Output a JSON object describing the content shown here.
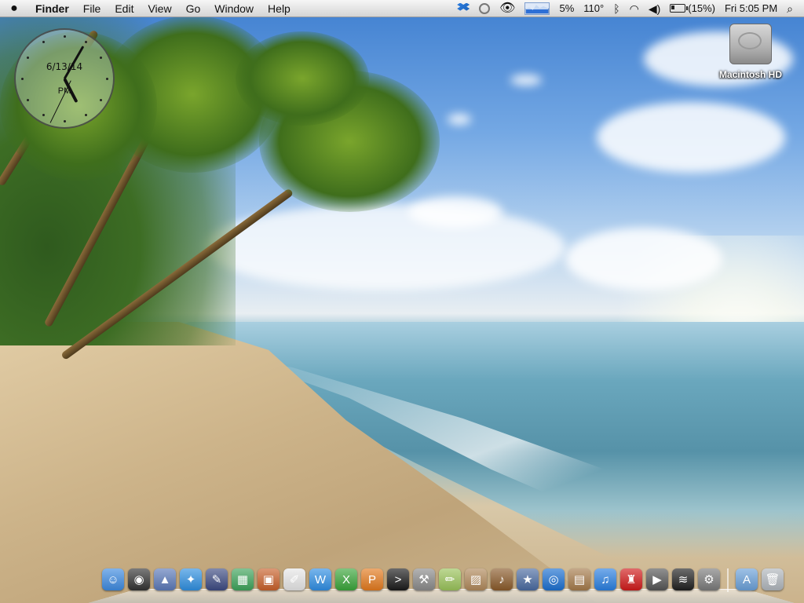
{
  "menubar": {
    "apple_icon": "apple-icon",
    "items": [
      "Finder",
      "File",
      "Edit",
      "View",
      "Go",
      "Window",
      "Help"
    ],
    "status": {
      "cpu_percent": "5%",
      "temperature": "110°",
      "battery_percent": "(15%)",
      "clock": "Fri 5:05 PM"
    }
  },
  "clock_widget": {
    "date": "6/13/14",
    "ampm": "PM",
    "hour": 5,
    "minute": 5
  },
  "desktop_icons": [
    {
      "label": "Macintosh HD",
      "icon": "hard-drive-icon"
    }
  ],
  "dock": {
    "apps": [
      {
        "name": "finder-icon",
        "color": "#3d8ae0",
        "glyph": "☺"
      },
      {
        "name": "dashboard-icon",
        "color": "#333333",
        "glyph": "◉"
      },
      {
        "name": "preview-icon",
        "color": "#5b79b8",
        "glyph": "▲"
      },
      {
        "name": "safari-icon",
        "color": "#2f8fe0",
        "glyph": "✦"
      },
      {
        "name": "quill-icon",
        "color": "#3c4a82",
        "glyph": "✎"
      },
      {
        "name": "numbers-icon",
        "color": "#3da35a",
        "glyph": "▦"
      },
      {
        "name": "keynote-icon",
        "color": "#c8602a",
        "glyph": "▣"
      },
      {
        "name": "textedit-icon",
        "color": "#e6e6e6",
        "glyph": "✐"
      },
      {
        "name": "word-icon",
        "color": "#2f8ee3",
        "glyph": "W"
      },
      {
        "name": "excel-icon",
        "color": "#3aa53a",
        "glyph": "X"
      },
      {
        "name": "powerpoint-icon",
        "color": "#e37a1e",
        "glyph": "P"
      },
      {
        "name": "terminal-icon",
        "color": "#1a1a1a",
        "glyph": ">"
      },
      {
        "name": "utility-icon",
        "color": "#8a8a8a",
        "glyph": "⚒"
      },
      {
        "name": "draw-icon",
        "color": "#9ac35a",
        "glyph": "✏"
      },
      {
        "name": "iphoto-icon",
        "color": "#b0885a",
        "glyph": "▨"
      },
      {
        "name": "garageband-icon",
        "color": "#8a5a2a",
        "glyph": "♪"
      },
      {
        "name": "imovie-icon",
        "color": "#4a6aa0",
        "glyph": "★"
      },
      {
        "name": "dvd-player-icon",
        "color": "#1b6fd0",
        "glyph": "◎"
      },
      {
        "name": "image-capture-icon",
        "color": "#a57a4a",
        "glyph": "▤"
      },
      {
        "name": "itunes-icon",
        "color": "#2a7fe0",
        "glyph": "♫"
      },
      {
        "name": "chair-icon",
        "color": "#d01a1a",
        "glyph": "♜"
      },
      {
        "name": "front-row-icon",
        "color": "#555555",
        "glyph": "▶"
      },
      {
        "name": "spotify-icon",
        "color": "#1f1f1f",
        "glyph": "≋"
      },
      {
        "name": "system-preferences-icon",
        "color": "#7a7a7a",
        "glyph": "⚙"
      }
    ],
    "right": [
      {
        "name": "applications-folder-icon",
        "color": "#6aa0d8",
        "glyph": "A"
      },
      {
        "name": "trash-icon",
        "color": "#b0b6bc",
        "glyph": "🗑"
      }
    ]
  }
}
